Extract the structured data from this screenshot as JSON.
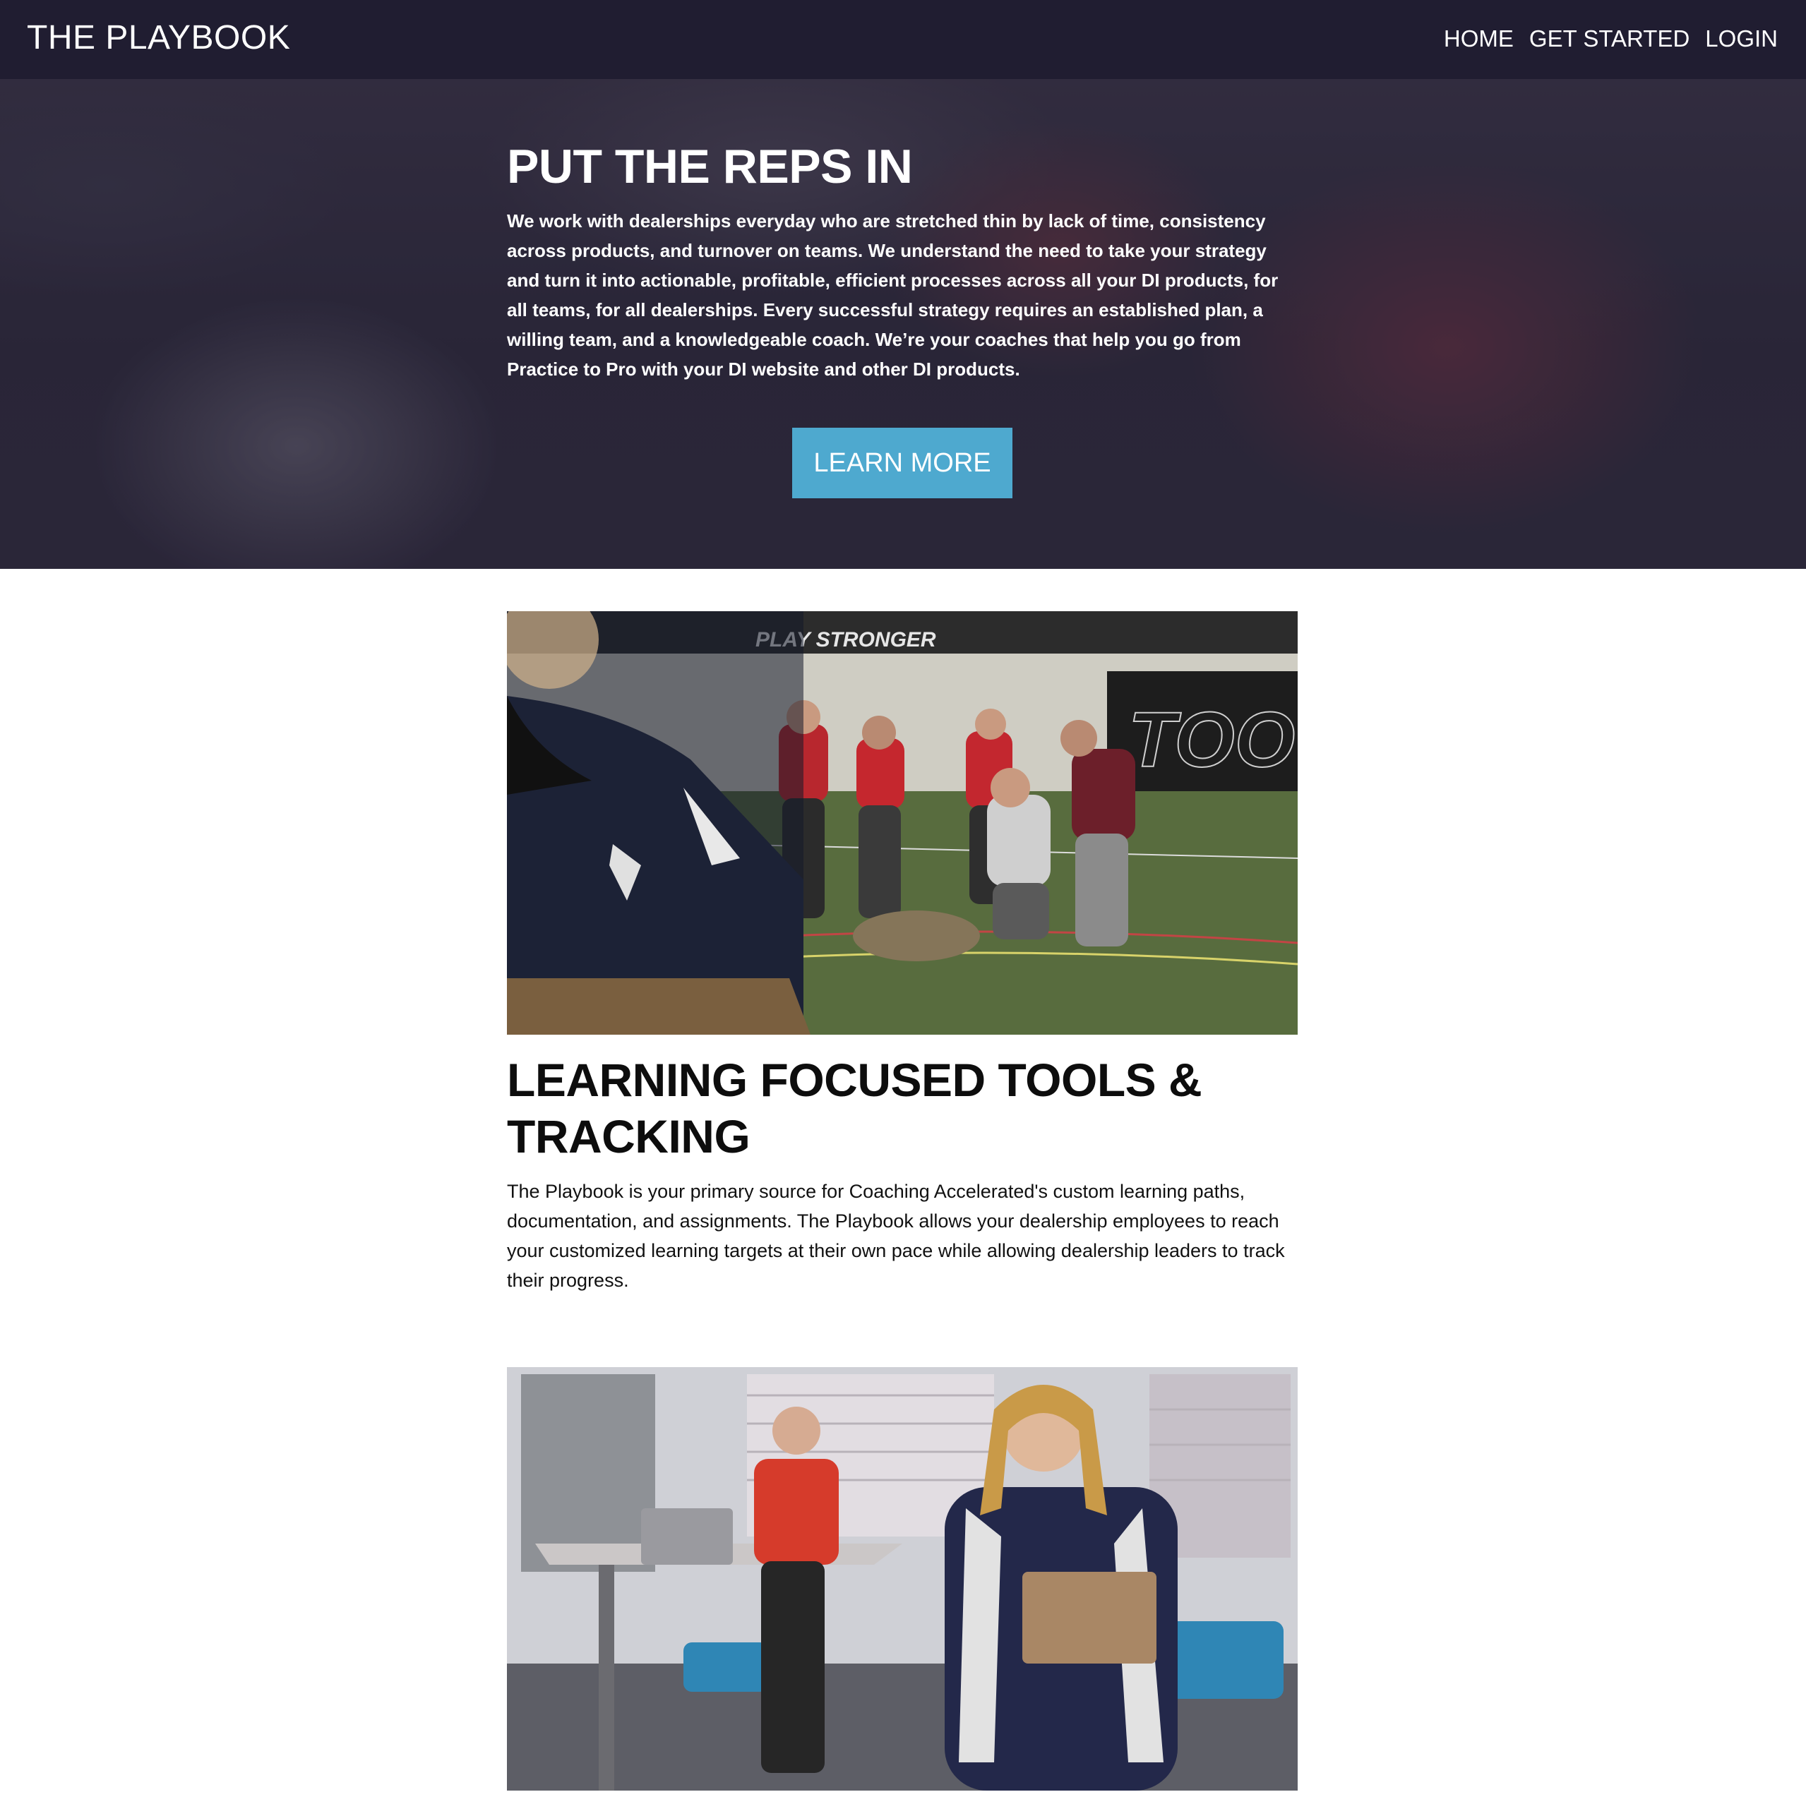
{
  "navbar": {
    "brand": "THE PLAYBOOK",
    "links": [
      {
        "label": "HOME"
      },
      {
        "label": "GET STARTED"
      },
      {
        "label": "LOGIN"
      }
    ]
  },
  "hero": {
    "title": "PUT THE REPS IN",
    "text": "We work with dealerships everyday who are stretched thin by lack of time, consistency across products, and turnover on teams. We understand the need to take your strategy and turn it into actionable, profitable, efficient processes across all your DI products, for all teams, for all dealerships. Every successful strategy requires an established plan, a willing team, and a knowledgeable coach. We’re your coaches that help you go from Practice to Pro with your DI website and other DI products.",
    "button_label": "LEARN MORE"
  },
  "feature": {
    "title": "LEARNING FOCUSED TOOLS & TRACKING",
    "text": "The Playbook is your primary source for Coaching Accelerated's custom learning paths, documentation, and assignments. The Playbook allows your dealership employees to reach your customized learning targets at their own pace while allowing dealership leaders to track their progress."
  },
  "photo_1": {
    "wall_text_1": "PLAY STRONGER",
    "wall_text_2": "TOO"
  },
  "colors": {
    "navbar_bg": "#201d31",
    "button_bg": "#4ea9cf",
    "hero_overlay": "#2d2a3b"
  }
}
